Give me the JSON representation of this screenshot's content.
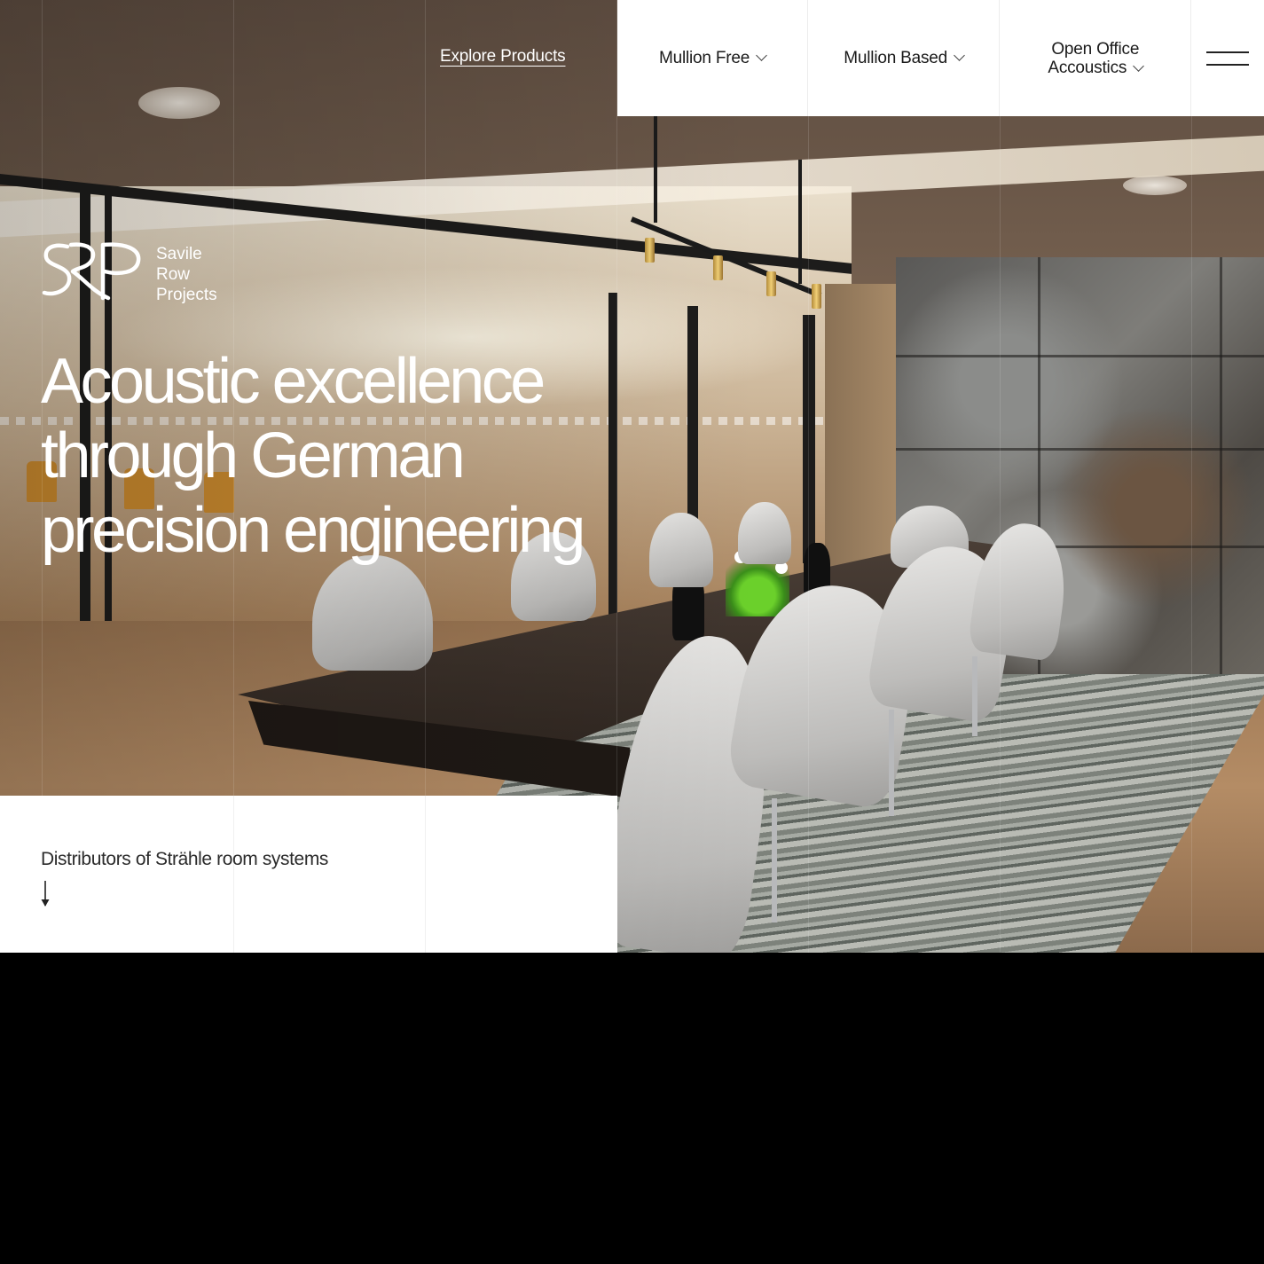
{
  "nav": {
    "explore_label": "Explore Products",
    "items": [
      {
        "label": "Mullion Free",
        "icon": "chevron-down-icon"
      },
      {
        "label": "Mullion Based",
        "icon": "chevron-down-icon"
      },
      {
        "label_line1": "Open Office",
        "label_line2": "Accoustics",
        "icon": "chevron-down-icon"
      }
    ],
    "menu_icon": "hamburger-menu-icon"
  },
  "logo": {
    "mark": "SRP",
    "line1": "Savile",
    "line2": "Row",
    "line3": "Projects"
  },
  "hero": {
    "headline_line1": "Acoustic excellence",
    "headline_line2": "through German",
    "headline_line3": "precision engineering",
    "image": "meeting-room-photo"
  },
  "intro": {
    "tagline": "Distributors of Strähle room systems",
    "scroll_icon": "arrow-down-icon"
  },
  "colors": {
    "panel_bg": "#ffffff",
    "text_dark": "#1a1a1a",
    "text_light": "#ffffff",
    "page_bg": "#000000"
  }
}
